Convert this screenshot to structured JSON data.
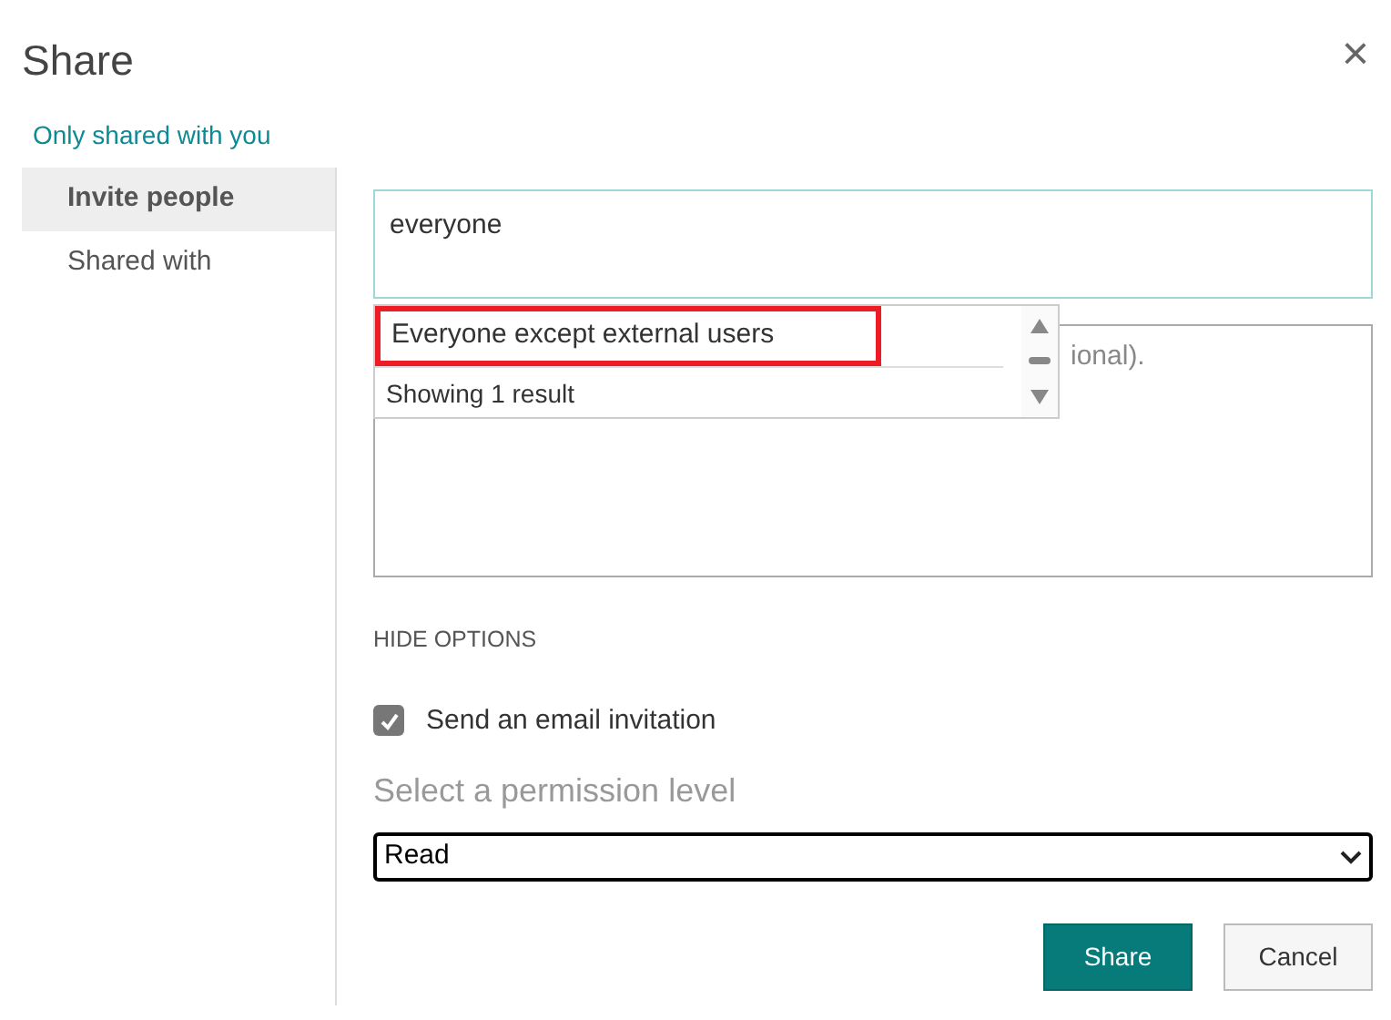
{
  "dialog": {
    "title": "Share",
    "close": "×",
    "subtitle": "Only shared with you"
  },
  "sidebar": {
    "items": [
      {
        "label": "Invite people",
        "selected": true
      },
      {
        "label": "Shared with",
        "selected": false
      }
    ]
  },
  "invite": {
    "value": "everyone",
    "suggestions": [
      {
        "label": "Everyone except external users",
        "highlighted": true
      }
    ],
    "result_count": "Showing 1 result",
    "message_visible": "ional)."
  },
  "options_toggle": "HIDE OPTIONS",
  "email_invitation": {
    "label": "Send an email invitation",
    "checked": true
  },
  "permission": {
    "label": "Select a permission level",
    "value": "Read"
  },
  "buttons": [
    {
      "label": "Share",
      "kind": "primary"
    },
    {
      "label": "Cancel",
      "kind": "secondary"
    }
  ]
}
